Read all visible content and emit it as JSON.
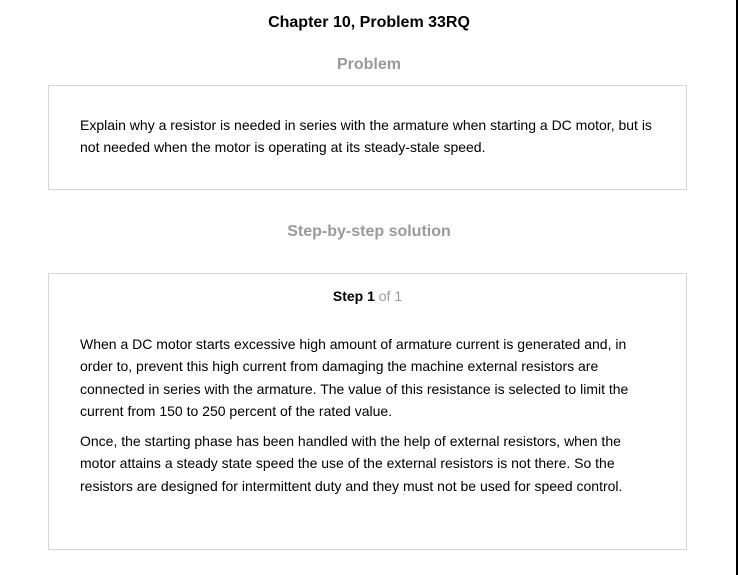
{
  "header": {
    "title": "Chapter 10, Problem 33RQ"
  },
  "problem": {
    "heading": "Problem",
    "text": "Explain why a resistor is needed in series with the armature when starting a DC motor, but is not needed when the motor is operating at its steady-stale speed."
  },
  "solution": {
    "heading": "Step-by-step solution",
    "step_label": "Step 1",
    "step_total": "of 1",
    "paragraphs": [
      "When a DC motor starts excessive high amount of armature current is generated and, in order to, prevent this high current from damaging the machine external resistors are connected in series with the armature. The value of this resistance is selected to limit the current from 150 to 250 percent of the rated value.",
      "Once, the starting phase has been handled with the help of external resistors, when the motor attains a steady state speed the use of the external resistors is not there. So the resistors are designed for intermittent duty and they must not be used for speed control."
    ]
  },
  "colors": {
    "heading_gray": "#9a9a9a",
    "border": "#d6d6d6",
    "text": "#000000"
  }
}
